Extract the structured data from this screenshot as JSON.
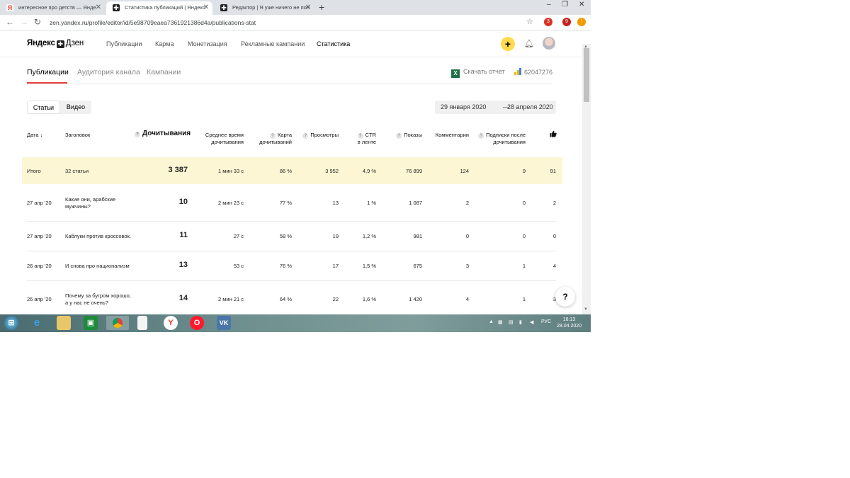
{
  "browser": {
    "tabs": [
      {
        "title": "интересное про детств — Янде",
        "favicon_color": "#f03c2e",
        "active": false
      },
      {
        "title": "Статистика публикаций | Яндекс.",
        "favicon_color": "#222222",
        "active": true
      },
      {
        "title": "Редактор | Я уже ничего не пон",
        "favicon_color": "#222222",
        "active": false
      }
    ],
    "new_tab": "+",
    "window_controls": [
      "–",
      "❐",
      "✕"
    ],
    "url": "zen.yandex.ru/profile/editor/id/5e98709eaea7361921386d4a/publications-stat",
    "ext_badge_1": "3",
    "ext_badge_2": "9"
  },
  "header": {
    "logo_brand": "Яндекс",
    "logo_product": "Дзен",
    "nav": [
      {
        "label": "Публикации"
      },
      {
        "label": "Карма"
      },
      {
        "label": "Монетизация"
      },
      {
        "label": "Рекламные кампании"
      },
      {
        "label": "Статистика"
      }
    ],
    "create_button": "+"
  },
  "subtabs": [
    {
      "label": "Публикации"
    },
    {
      "label": "Аудитория канала"
    },
    {
      "label": "Кампании"
    }
  ],
  "download_report": "Скачать отчет",
  "channel_id": "62047276",
  "content_type": {
    "articles": "Статьи",
    "videos": "Видео"
  },
  "date_range": {
    "from": "29 января 2020",
    "separator": "—",
    "to": "28 апреля 2020"
  },
  "table": {
    "headers": {
      "date": "Дата ↓",
      "title": "Заголовок",
      "reads": "Дочитывания",
      "avg_time_1": "Среднее время",
      "avg_time_2": "дочитывания",
      "card_1": "Карта",
      "card_2": "дочитываний",
      "views": "Просмотры",
      "ctr_1": "CTR",
      "ctr_2": "в ленте",
      "impressions": "Показы",
      "comments": "Комментарии",
      "subs_1": "Подписки после",
      "subs_2": "дочитывания",
      "likes_icon": "thumbs-up"
    },
    "total": {
      "date": "Итого",
      "title": "32 статьи",
      "reads": "3 387",
      "avg_time": "1 мин 33 с",
      "card": "86 %",
      "views": "3 952",
      "ctr": "4,9 %",
      "impressions": "76 899",
      "comments": "124",
      "subs": "9",
      "likes": "91"
    },
    "rows": [
      {
        "date": "27 апр '20",
        "title_1": "Какие они, арабские",
        "title_2": "мужчины?",
        "reads": "10",
        "avg_time": "2 мин 23 с",
        "card": "77 %",
        "views": "13",
        "ctr": "1 %",
        "impressions": "1 087",
        "comments": "2",
        "subs": "0",
        "likes": "2"
      },
      {
        "date": "27 апр '20",
        "title_1": "Каблуки против кроссовок.",
        "title_2": "",
        "reads": "11",
        "avg_time": "27 с",
        "card": "58 %",
        "views": "19",
        "ctr": "1,2 %",
        "impressions": "981",
        "comments": "0",
        "subs": "0",
        "likes": "0"
      },
      {
        "date": "26 апр '20",
        "title_1": "И снова про национализм",
        "title_2": "",
        "reads": "13",
        "avg_time": "53 с",
        "card": "76 %",
        "views": "17",
        "ctr": "1,5 %",
        "impressions": "675",
        "comments": "3",
        "subs": "1",
        "likes": "4"
      },
      {
        "date": "26 апр '20",
        "title_1": "Почему за бугром хорошо,",
        "title_2": "а у нас не очень?",
        "reads": "14",
        "avg_time": "2 мин 21 с",
        "card": "64 %",
        "views": "22",
        "ctr": "1,6 %",
        "impressions": "1 420",
        "comments": "4",
        "subs": "1",
        "likes": "3"
      }
    ]
  },
  "help_button": "?",
  "taskbar": {
    "language": "РУС",
    "time": "16:13",
    "date": "28.04.2020"
  }
}
